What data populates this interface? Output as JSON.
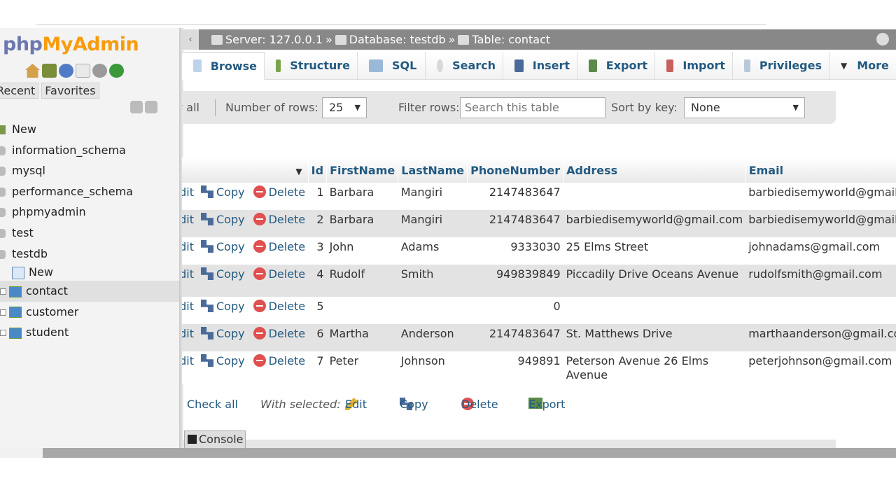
{
  "logo": {
    "php": "php",
    "my": "MyAdmin"
  },
  "sidebar": {
    "tabs": [
      "Recent",
      "Favorites"
    ],
    "tree": [
      {
        "label": "New"
      },
      {
        "label": "information_schema"
      },
      {
        "label": "mysql"
      },
      {
        "label": "performance_schema"
      },
      {
        "label": "phpmyadmin"
      },
      {
        "label": "test"
      },
      {
        "label": "testdb"
      }
    ],
    "subtree": [
      {
        "label": "New"
      },
      {
        "label": "contact"
      },
      {
        "label": "customer"
      },
      {
        "label": "student"
      }
    ]
  },
  "breadcrumb": {
    "server": "Server: 127.0.0.1",
    "database": "Database: testdb",
    "table": "Table: contact",
    "separator": "»"
  },
  "tabs": [
    "Browse",
    "Structure",
    "SQL",
    "Search",
    "Insert",
    "Export",
    "Import",
    "Privileges",
    "More"
  ],
  "navbar": {
    "show_all": "Show all",
    "rows_label": "Number of rows:",
    "rows_value": "25",
    "filter_label": "Filter rows:",
    "filter_placeholder": "Search this table",
    "sort_label": "Sort by key:",
    "sort_value": "None"
  },
  "table": {
    "headers": [
      "Id",
      "FirstName",
      "LastName",
      "PhoneNumber",
      "Address",
      "Email"
    ],
    "action_labels": {
      "edit": "Edit",
      "copy": "Copy",
      "delete": "Delete"
    },
    "rows": [
      {
        "id": "1",
        "first": "Barbara",
        "last": "Mangiri",
        "phone": "2147483647",
        "address": "",
        "email": "barbiedisemyworld@gmail.com"
      },
      {
        "id": "2",
        "first": "Barbara",
        "last": "Mangiri",
        "phone": "2147483647",
        "address": "barbiedisemyworld@gmail.com",
        "email": "barbiedisemyworld@gmail.com"
      },
      {
        "id": "3",
        "first": "John",
        "last": "Adams",
        "phone": "9333030",
        "address": "25 Elms Street",
        "email": "johnadams@gmail.com"
      },
      {
        "id": "4",
        "first": "Rudolf",
        "last": "Smith",
        "phone": "949839849",
        "address": "Piccadily Drive Oceans Avenue",
        "email": "rudolfsmith@gmail.com"
      },
      {
        "id": "5",
        "first": "",
        "last": "",
        "phone": "0",
        "address": "",
        "email": ""
      },
      {
        "id": "6",
        "first": "Martha",
        "last": "Anderson",
        "phone": "2147483647",
        "address": "St. Matthews Drive",
        "email": "marthaanderson@gmail.com"
      },
      {
        "id": "7",
        "first": "Peter",
        "last": "Johnson",
        "phone": "949891",
        "address": "Peterson Avenue 26 Elms Avenue",
        "email": "peterjohnson@gmail.com"
      }
    ]
  },
  "bottom": {
    "check_all": "Check all",
    "with_selected": "With selected:",
    "edit": "Edit",
    "copy": "Copy",
    "delete": "Delete",
    "export": "Export"
  },
  "console": {
    "label": "Console"
  }
}
